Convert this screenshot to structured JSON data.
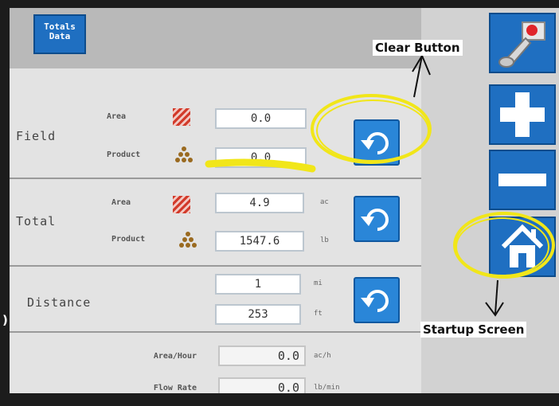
{
  "header": {
    "tab_label": "Totals Data"
  },
  "field": {
    "label": "Field",
    "area_label": "Area",
    "area_value": "0.0",
    "product_label": "Product",
    "product_value": "0.0"
  },
  "total": {
    "label": "Total",
    "area_label": "Area",
    "area_value": "4.9",
    "area_unit": "ac",
    "product_label": "Product",
    "product_value": "1547.6",
    "product_unit": "lb"
  },
  "distance": {
    "label": "Distance",
    "mi_value": "1",
    "mi_unit": "mi",
    "ft_value": "253",
    "ft_unit": "ft"
  },
  "rates": {
    "area_hour_label": "Area/Hour",
    "area_hour_value": "0.0",
    "area_hour_unit": "ac/h",
    "flow_rate_label": "Flow Rate",
    "flow_rate_value": "0.0",
    "flow_rate_unit": "lb/min"
  },
  "annotations": {
    "clear_button": "Clear Button",
    "startup_screen": "Startup Screen",
    "edge_mark": ")"
  },
  "icons": {
    "side": [
      "joystick-icon",
      "plus-icon",
      "minus-icon",
      "home-icon"
    ],
    "reset": "reset-arrow-icon"
  },
  "colors": {
    "button_blue": "#1f6fc1",
    "highlight_yellow": "#f1e619"
  }
}
